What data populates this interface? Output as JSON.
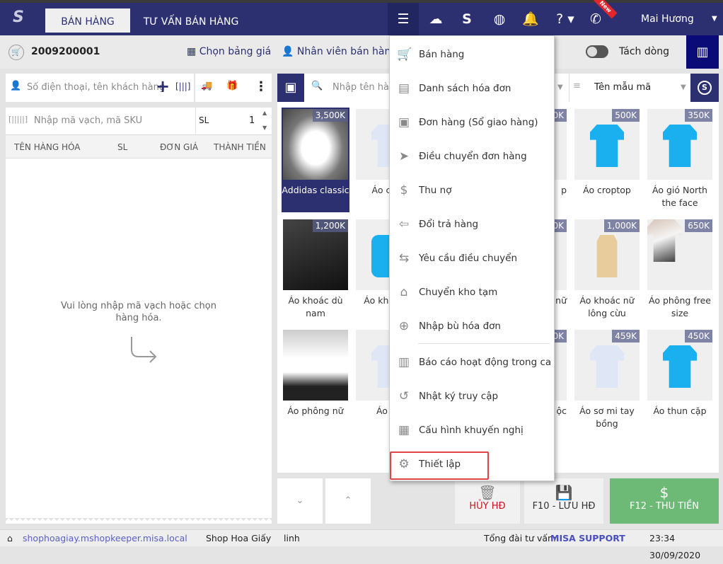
{
  "header": {
    "tabs": [
      {
        "label": "BÁN HÀNG"
      },
      {
        "label": "TƯ VẤN BÁN HÀNG"
      }
    ],
    "new_badge": "New",
    "user": "Mai Hương"
  },
  "subbar": {
    "invoice_no": "2009200001",
    "price_list": "Chọn bảng giá",
    "staff": "Nhân viên bán hàng",
    "split_label": "Tách dòng"
  },
  "cart": {
    "customer_placeholder": "Số điện thoại, tên khách hàng",
    "barcode_placeholder": "Nhập mã vạch, mã SKU",
    "qty_label": "SL",
    "qty_value": "1",
    "columns": [
      "TÊN HÀNG HÓA",
      "SL",
      "ĐƠN GIÁ",
      "THÀNH TIỀN"
    ],
    "empty_msg": "Vui lòng nhập mã vạch hoặc chọn hàng hóa."
  },
  "catalog": {
    "search_placeholder": "Nhập tên hàn",
    "sort_label": "Tên mẫu mã",
    "items": [
      {
        "name": "Addidas classic",
        "price": "3,500K",
        "img": "shoes"
      },
      {
        "name": "Áo cổ V",
        "price": "",
        "img": "white"
      },
      {
        "name": "",
        "price": "",
        "img": "white"
      },
      {
        "name": "p",
        "price": "0K",
        "img": "white"
      },
      {
        "name": "Áo croptop",
        "price": "500K",
        "img": "tee"
      },
      {
        "name": "Áo gió North the face",
        "price": "350K",
        "img": "tee"
      },
      {
        "name": "Áo khoác dù nam",
        "price": "1,200K",
        "img": "dark"
      },
      {
        "name": "Áo kho cừu",
        "price": "",
        "img": "blue"
      },
      {
        "name": "",
        "price": "",
        "img": "white"
      },
      {
        "name": "nữ",
        "price": "0K",
        "img": "white"
      },
      {
        "name": "Áo khoác nữ lông cừu",
        "price": "1,000K",
        "img": "coat"
      },
      {
        "name": "Áo phông free size",
        "price": "650K",
        "img": "phototee"
      },
      {
        "name": "Áo phông nữ",
        "price": "",
        "img": "girl"
      },
      {
        "name": "Áo sơ",
        "price": "",
        "img": "white"
      },
      {
        "name": "",
        "price": "",
        "img": "white"
      },
      {
        "name": "ố ộc",
        "price": "0K",
        "img": "white"
      },
      {
        "name": "Áo sơ mi tay bồng",
        "price": "459K",
        "img": "white"
      },
      {
        "name": "Áo thun cặp",
        "price": "450K",
        "img": "tee"
      }
    ]
  },
  "menu": {
    "items": [
      {
        "label": "Bán hàng",
        "icon": "cart-icon",
        "glyph": "🛒"
      },
      {
        "label": "Danh sách hóa đơn",
        "icon": "document-icon",
        "glyph": "▤"
      },
      {
        "label": "Đơn hàng (Sổ giao hàng)",
        "icon": "truck-icon",
        "glyph": "▣"
      },
      {
        "label": "Điều chuyển đơn hàng",
        "icon": "send-icon",
        "glyph": "➤"
      },
      {
        "label": "Thu nợ",
        "icon": "money-bag-icon",
        "glyph": "$"
      },
      {
        "label": "Đổi trả hàng",
        "icon": "return-icon",
        "glyph": "⇦"
      },
      {
        "label": "Yêu cầu điều chuyển",
        "icon": "transfer-icon",
        "glyph": "⇆"
      },
      {
        "label": "Chuyển kho tạm",
        "icon": "warehouse-icon",
        "glyph": "⌂"
      },
      {
        "label": "Nhập bù hóa đơn",
        "icon": "add-invoice-icon",
        "glyph": "⊕"
      },
      {
        "label": "Báo cáo hoạt động trong ca",
        "icon": "report-icon",
        "glyph": "▥"
      },
      {
        "label": "Nhật ký truy cập",
        "icon": "history-icon",
        "glyph": "↺"
      },
      {
        "label": "Cấu hình khuyến nghị",
        "icon": "config-icon",
        "glyph": "▦"
      },
      {
        "label": "Thiết lập",
        "icon": "gear-icon",
        "glyph": "⚙"
      }
    ]
  },
  "actions": {
    "cancel": "HỦY HĐ",
    "save": "F10 - LƯU HĐ",
    "pay": "F12 - THU TIỀN"
  },
  "status": {
    "url": "shophoagiay.mshopkeeper.misa.local",
    "shop": "Shop Hoa Giấy",
    "user": "linh",
    "hotline_label": "Tổng đài tư vấn:",
    "hotline": "MISA SUPPORT",
    "datetime": "23:34 30/09/2020"
  }
}
